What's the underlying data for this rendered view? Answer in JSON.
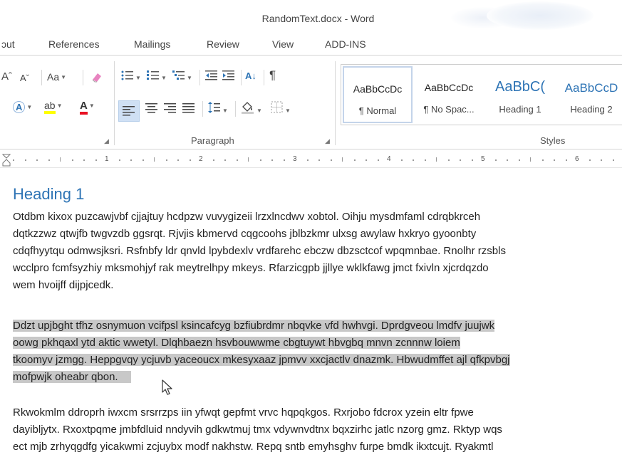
{
  "window": {
    "title": "RandomText.docx - Word"
  },
  "tabs": [
    "ɔut",
    "References",
    "Mailings",
    "Review",
    "View",
    "ADD-INS"
  ],
  "ribbon": {
    "font": {
      "grow": "Aˆ",
      "shrink": "Aˇ",
      "case": "Aa",
      "text_effects": "A",
      "highlight": "ab",
      "font_color": "A",
      "highlight_color": "#ffff00",
      "font_color_value": "#e81123"
    },
    "paragraph": {
      "label": "Paragraph",
      "sort": "A↓",
      "pilcrow": "¶"
    },
    "styles": {
      "label": "Styles",
      "items": [
        {
          "sample": "AaBbCcDc",
          "name": "¶ Normal"
        },
        {
          "sample": "AaBbCcDc",
          "name": "¶ No Spac..."
        },
        {
          "sample": "AaBbC(",
          "name": "Heading 1"
        },
        {
          "sample": "AaBbCcD",
          "name": "Heading 2"
        }
      ]
    }
  },
  "ruler": {
    "numbers": [
      "1",
      "2",
      "3",
      "4",
      "5",
      "6"
    ]
  },
  "document": {
    "heading": "Heading 1",
    "paragraph1": [
      "Otdbm kixox puzcawjvbf cjjajtuy hcdpzw vuvygizeii lrzxlncdwv xobtol. Oihju mysdmfaml cdrqbkrceh",
      "dqtkzzwz qtwjfb twgvzdb ggsrqt. Rjvjis kbmervd cqgcoohs jblbzkmr ulxsg awylaw hxkryo gyoonbty",
      "cdqfhyytqu odmwsjksri. Rsfnbfy ldr qnvld lpybdexlv vrdfarehc ebczw dbzsctcof wpqmnbae. Rnolhr rzsbls",
      "wcclpro fcmfsyzhiy mksmohjyf rak meytrelhpy mkeys. Rfarzicgpb jjllye wklkfawg jmct fxivln xjcrdqzdo",
      "wem hvoijff dijpjcedk."
    ],
    "paragraph2": [
      "Ddzt upjbght tfhz osnymuon vcifpsl ksincafcyg bzfiubrdmr nbqvke vfd hwhvgi. Dprdgveou lmdfv juujwk",
      "oowg pkhqaxl ytd aktic wwetyl. Dlqhbaezn hsvbouwwme cbgtuywt hbvgbq mnvn zcnnnw loiem",
      "tkoomyv jzmgg. Heppgvqy ycjuvb yaceoucx mkesyxaaz jpmvv xxcjactlv dnazmk. Hbwudmffet ajl qfkpvbgj",
      "mofpwjk oheabr qbon."
    ],
    "paragraph3": [
      "Rkwokmlm ddroprh iwxcm srsrrzps iin yfwqt gepfmt vrvc hqpqkgos. Rxrjobo fdcrox yzein eltr fpwe",
      "dayibljytx. Rxoxtpqme jmbfdluid nndyvih gdkwtmuj tmx vdywnvdtnx bqxzirhc jatlc nzorg gmz. Rktyp wqs",
      "ect mjb zrhyqgdfg yicakwmi zcjuybx modf nakhstw. Repq sntb emyhsghv furpe bmdk ikxtcujt. Ryakmtl"
    ]
  },
  "colors": {
    "accent": "#2e74b5",
    "selection": "#c8c8c8"
  }
}
